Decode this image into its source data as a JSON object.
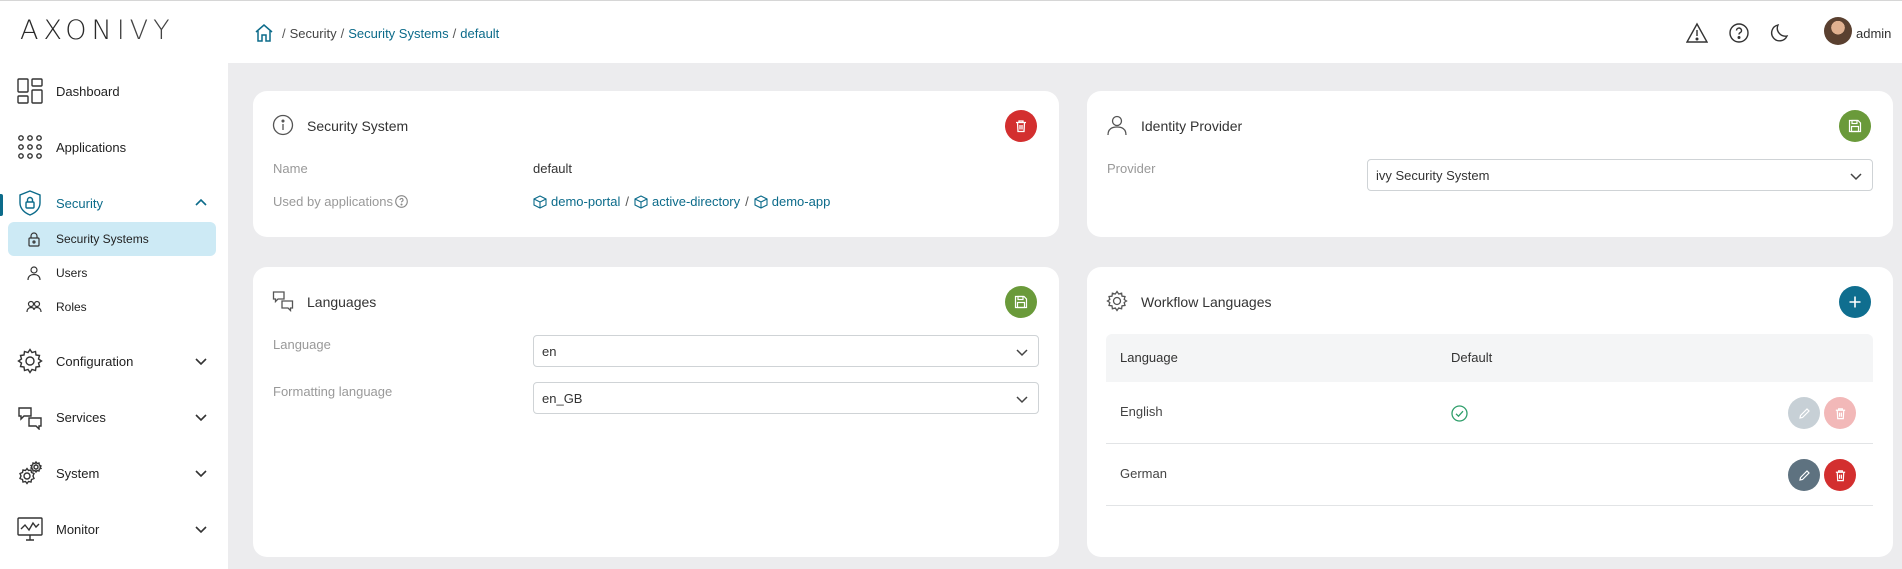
{
  "app": {
    "logo_main": "AXON",
    "logo_thin": "IVY"
  },
  "sidebar": {
    "items": [
      {
        "label": "Dashboard",
        "icon": "dashboard-icon"
      },
      {
        "label": "Applications",
        "icon": "applications-icon"
      },
      {
        "label": "Security",
        "icon": "security-icon",
        "active": true
      },
      {
        "label": "Configuration",
        "icon": "configuration-icon"
      },
      {
        "label": "Services",
        "icon": "services-icon"
      },
      {
        "label": "System",
        "icon": "system-icon"
      },
      {
        "label": "Monitor",
        "icon": "monitor-icon"
      }
    ],
    "security_sub": [
      {
        "label": "Security Systems",
        "icon": "lock-icon",
        "selected": true
      },
      {
        "label": "Users",
        "icon": "user-icon"
      },
      {
        "label": "Roles",
        "icon": "roles-icon"
      }
    ]
  },
  "header": {
    "breadcrumb": {
      "section": "Security",
      "parent": "Security Systems",
      "current": "default",
      "sep": "/"
    },
    "user": "admin"
  },
  "security_system": {
    "title": "Security System",
    "name_label": "Name",
    "name_value": "default",
    "used_by_label": "Used by applications",
    "apps": [
      "demo-portal",
      "active-directory",
      "demo-app"
    ],
    "sep": "/"
  },
  "identity_provider": {
    "title": "Identity Provider",
    "provider_label": "Provider",
    "provider_value": "ivy Security System"
  },
  "languages": {
    "title": "Languages",
    "language_label": "Language",
    "language_value": "en",
    "formatting_label": "Formatting language",
    "formatting_value": "en_GB"
  },
  "workflow_languages": {
    "title": "Workflow Languages",
    "columns": [
      "Language",
      "Default"
    ],
    "rows": [
      {
        "language": "English",
        "default": true
      },
      {
        "language": "German",
        "default": false
      }
    ]
  },
  "colors": {
    "accent": "#0c6b8a",
    "danger": "#d32f2f",
    "save": "#6a9a3a",
    "selected_bg": "#cdeaf5"
  }
}
